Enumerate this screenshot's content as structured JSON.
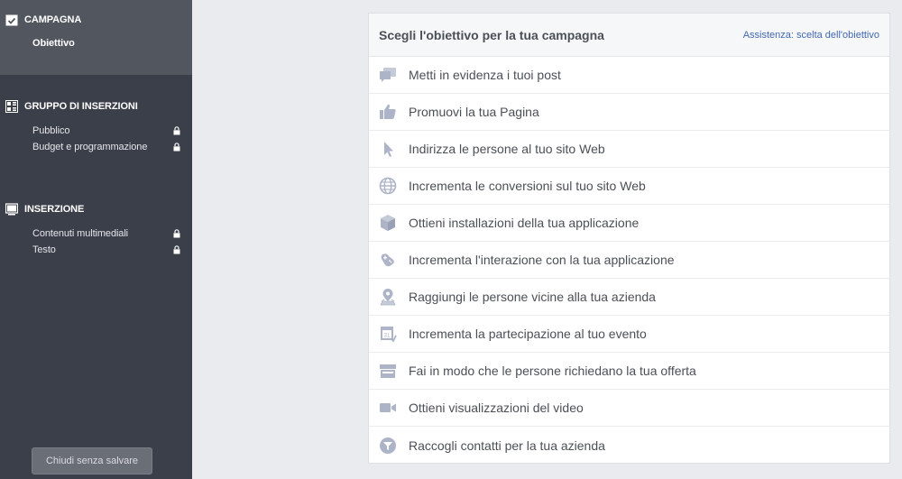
{
  "sidebar": {
    "campagna": {
      "title": "CAMPAGNA",
      "icon": "checklist-icon",
      "items": [
        {
          "label": "Obiettivo",
          "active": true,
          "locked": false
        }
      ]
    },
    "gruppo": {
      "title": "GRUPPO DI INSERZIONI",
      "icon": "grid-icon",
      "items": [
        {
          "label": "Pubblico",
          "locked": true
        },
        {
          "label": "Budget e programmazione",
          "locked": true
        }
      ]
    },
    "inserzione": {
      "title": "INSERZIONE",
      "icon": "monitor-icon",
      "items": [
        {
          "label": "Contenuti multimediali",
          "locked": true
        },
        {
          "label": "Testo",
          "locked": true
        }
      ]
    },
    "close_button": "Chiudi senza salvare"
  },
  "main": {
    "title": "Scegli l'obiettivo per la tua campagna",
    "help_link": "Assistenza: scelta dell'obiettivo",
    "objectives": [
      {
        "label": "Metti in evidenza i tuoi post",
        "icon": "speech-bubbles-icon"
      },
      {
        "label": "Promuovi la tua Pagina",
        "icon": "thumbs-up-icon"
      },
      {
        "label": "Indirizza le persone al tuo sito Web",
        "icon": "cursor-icon"
      },
      {
        "label": "Incrementa le conversioni sul tuo sito Web",
        "icon": "globe-icon"
      },
      {
        "label": "Ottieni installazioni della tua applicazione",
        "icon": "box-icon"
      },
      {
        "label": "Incrementa l'interazione con la tua applicazione",
        "icon": "gamepad-icon"
      },
      {
        "label": "Raggiungi le persone vicine alla tua azienda",
        "icon": "map-pin-icon"
      },
      {
        "label": "Incrementa la partecipazione al tuo evento",
        "icon": "calendar-icon"
      },
      {
        "label": "Fai in modo che le persone richiedano la tua offerta",
        "icon": "store-icon"
      },
      {
        "label": "Ottieni visualizzazioni del video",
        "icon": "video-camera-icon"
      },
      {
        "label": "Raccogli contatti per la tua azienda",
        "icon": "funnel-icon"
      }
    ]
  },
  "colors": {
    "sidebar_bg": "#3b3f4a",
    "sidebar_active_bg": "#52565f",
    "page_bg": "#e9ebee",
    "link": "#4267b2",
    "icon": "#aeb4c7"
  }
}
